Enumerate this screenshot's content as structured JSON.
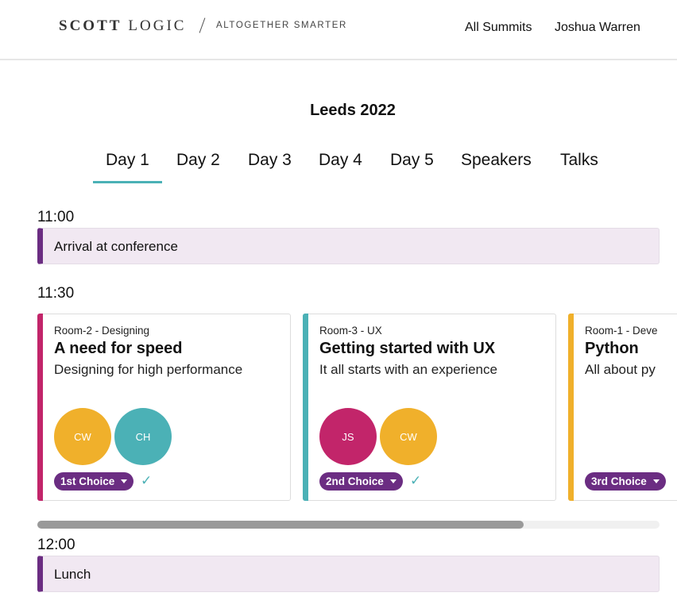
{
  "header": {
    "logo_scott": "SCOTT",
    "logo_logic": "LOGIC",
    "tagline": "ALTOGETHER SMARTER",
    "nav": {
      "summits": "All Summits",
      "user": "Joshua Warren"
    }
  },
  "event": {
    "title": "Leeds 2022"
  },
  "tabs": [
    {
      "label": "Day 1",
      "active": true
    },
    {
      "label": "Day 2"
    },
    {
      "label": "Day 3"
    },
    {
      "label": "Day 4"
    },
    {
      "label": "Day 5"
    },
    {
      "label": "Speakers"
    },
    {
      "label": "Talks"
    }
  ],
  "schedule": [
    {
      "time": "11:00",
      "title": "Arrival at conference"
    },
    {
      "time": "11:30",
      "sessions": [
        {
          "room": "Room-2 - Designing",
          "title": "A need for speed",
          "subtitle": "Designing for high performance",
          "color": "#c2256a",
          "speakers": [
            {
              "initials": "CW",
              "color": "#f0b02b"
            },
            {
              "initials": "CH",
              "color": "#4bb1b6"
            }
          ],
          "choice": "1st Choice",
          "selected_mark": "✓"
        },
        {
          "room": "Room-3 - UX",
          "title": "Getting started with UX",
          "subtitle": "It all starts with an experience",
          "color": "#4bb1b6",
          "speakers": [
            {
              "initials": "JS",
              "color": "#c2256a"
            },
            {
              "initials": "CW",
              "color": "#f0b02b"
            }
          ],
          "choice": "2nd Choice",
          "selected_mark": "✓"
        },
        {
          "room": "Room-1 - Deve",
          "title": "Python",
          "subtitle": "All about py",
          "color": "#f0b02b",
          "speakers": [],
          "choice": "3rd Choice"
        }
      ]
    },
    {
      "time": "12:00",
      "title": "Lunch"
    }
  ],
  "colors": {
    "accent": "#4bb1b6",
    "brand_purple": "#6b2d82",
    "break_bg": "#f1e8f2"
  },
  "carousel_scroll_fraction": 0.78
}
